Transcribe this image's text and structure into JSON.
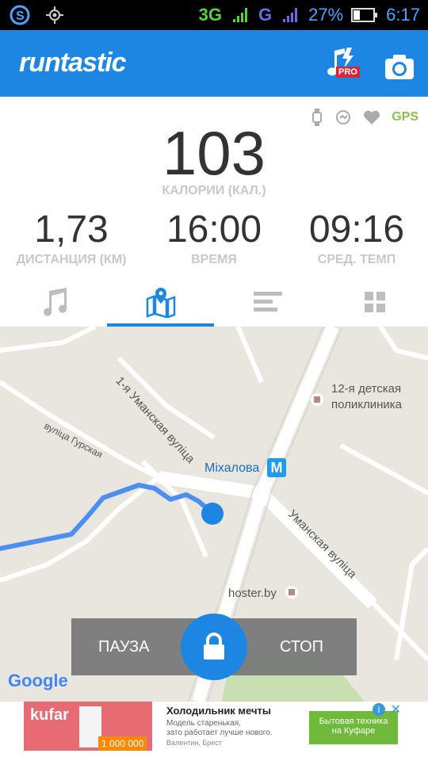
{
  "status": {
    "network": "3G",
    "network2": "G",
    "battery_pct": "27%",
    "time": "6:17"
  },
  "header": {
    "logo": "runtastic",
    "pro_badge": "PRO"
  },
  "sensors": {
    "gps": "GPS"
  },
  "stats": {
    "calories": {
      "value": "103",
      "label": "КАЛОРИИ (КАЛ.)"
    },
    "distance": {
      "value": "1,73",
      "label": "ДИСТАНЦИЯ (КМ)"
    },
    "time": {
      "value": "16:00",
      "label": "ВРЕМЯ"
    },
    "pace": {
      "value": "09:16",
      "label": "СРЕД. ТЕМП"
    }
  },
  "tabs": [
    {
      "name": "music",
      "icon": "music-note-icon",
      "active": false
    },
    {
      "name": "map",
      "icon": "map-pin-icon",
      "active": true
    },
    {
      "name": "stats",
      "icon": "bars-icon",
      "active": false
    },
    {
      "name": "grid",
      "icon": "grid-icon",
      "active": false
    }
  ],
  "map": {
    "labels": {
      "street1": "1-я Уманская вуліца",
      "street2": "вуліца Гурская",
      "street3": "Уманская вуліца",
      "poi1_line1": "12-я детская",
      "poi1_line2": "поликлиника",
      "metro": "Міхалова",
      "metro_badge": "M",
      "poi2": "hoster.by"
    },
    "google": "Google"
  },
  "controls": {
    "pause": "ПАУЗА",
    "stop": "СТОП"
  },
  "ad": {
    "brand": "kufar",
    "price": "1 000 000",
    "title": "Холодильник мечты",
    "line1": "Модель старенькая,",
    "line2": "зато работает лучше нового.",
    "line3": "Валентин, Брест",
    "cta_line1": "Бытовая техника",
    "cta_line2": "на Куфаре"
  },
  "colors": {
    "accent": "#1d86e3",
    "gps": "#8bc34a",
    "route": "#4c8ff0"
  }
}
